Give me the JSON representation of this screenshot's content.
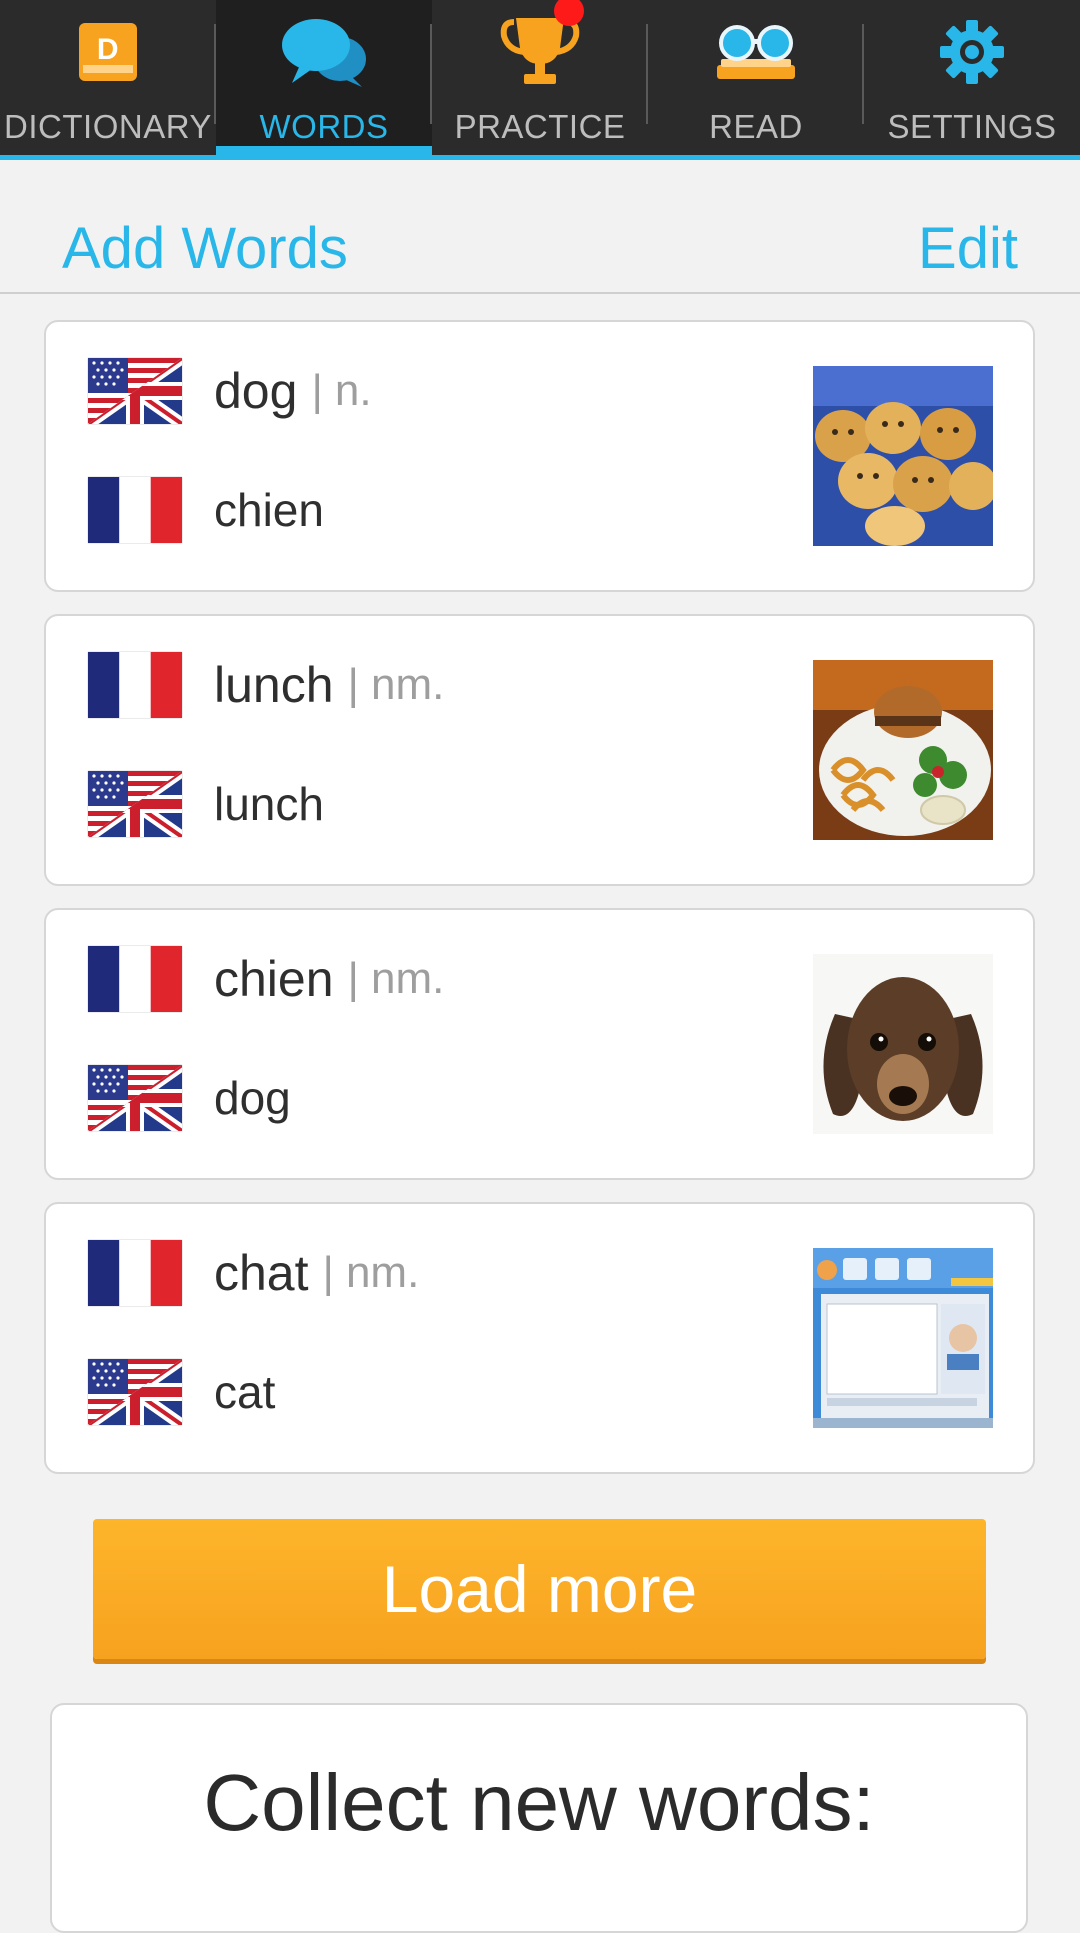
{
  "tabs": [
    {
      "label": "DICTIONARY",
      "icon": "dictionary-book-icon",
      "active": false
    },
    {
      "label": "WORDS",
      "icon": "chat-bubbles-icon",
      "active": true
    },
    {
      "label": "PRACTICE",
      "icon": "trophy-icon",
      "active": false,
      "notification": true
    },
    {
      "label": "READ",
      "icon": "reading-glasses-icon",
      "active": false
    },
    {
      "label": "SETTINGS",
      "icon": "gear-icon",
      "active": false
    }
  ],
  "actions": {
    "add_words": "Add Words",
    "edit": "Edit"
  },
  "cards": [
    {
      "term": "dog",
      "pos": "n.",
      "term_flag": "us-uk-flag-icon",
      "translation": "chien",
      "translation_flag": "france-flag-icon",
      "image": "puppies-photo"
    },
    {
      "term": "lunch",
      "pos": "nm.",
      "term_flag": "france-flag-icon",
      "translation": "lunch",
      "translation_flag": "us-uk-flag-icon",
      "image": "burger-plate-photo"
    },
    {
      "term": "chien",
      "pos": "nm.",
      "term_flag": "france-flag-icon",
      "translation": "dog",
      "translation_flag": "us-uk-flag-icon",
      "image": "dachshund-photo"
    },
    {
      "term": "chat",
      "pos": "nm.",
      "term_flag": "france-flag-icon",
      "translation": "cat",
      "translation_flag": "us-uk-flag-icon",
      "image": "web-chat-screenshot"
    }
  ],
  "load_more": "Load more",
  "collect": {
    "title": "Collect new words:"
  },
  "colors": {
    "accent": "#29b6e8",
    "tabbar_bg": "#2b2b2b",
    "button": "#f7a21f",
    "notification": "#ff1a1a"
  }
}
